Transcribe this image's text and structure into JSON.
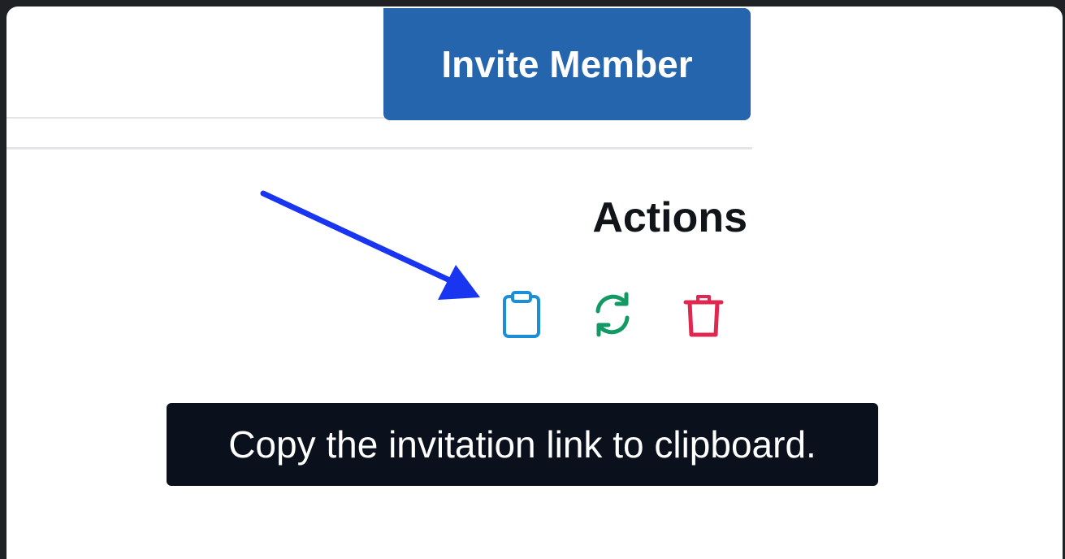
{
  "toolbar": {
    "invite_label": "Invite Member"
  },
  "table": {
    "actions_header": "Actions"
  },
  "actions": [
    {
      "icon": "clipboard-icon",
      "color": "#1a8fd6"
    },
    {
      "icon": "refresh-icon",
      "color": "#129a64"
    },
    {
      "icon": "trash-icon",
      "color": "#e0274f"
    }
  ],
  "tooltip": {
    "text": "Copy the invitation link to clipboard."
  },
  "colors": {
    "primary": "#2465ad",
    "annotation_arrow": "#1a35f0",
    "tooltip_bg": "#0b111c"
  }
}
